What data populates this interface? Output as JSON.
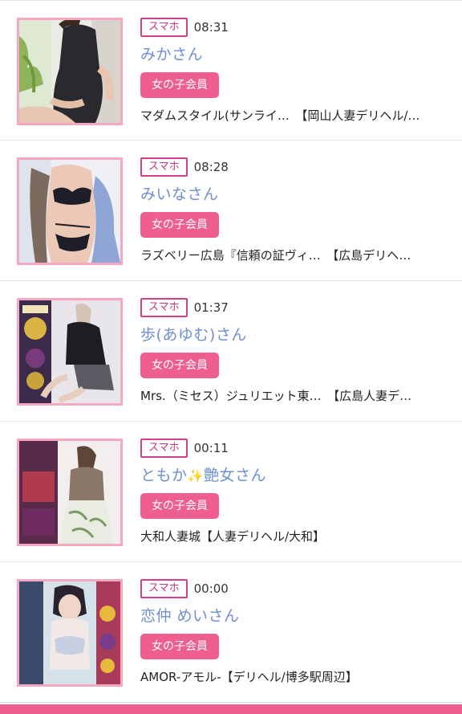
{
  "entries": [
    {
      "device": "スマホ",
      "time": "08:31",
      "name": "みかさん",
      "badge": "女の子会員",
      "shop": "マダムスタイル(サンライ…　【岡山人妻デリヘル/…",
      "thumb_icon": "woman-black-dress-photo"
    },
    {
      "device": "スマホ",
      "time": "08:28",
      "name": "みいなさん",
      "badge": "女の子会員",
      "shop": "ラズベリー広島『信頼の証ヴィ…　【広島デリヘ…",
      "thumb_icon": "woman-lingerie-photo"
    },
    {
      "device": "スマホ",
      "time": "01:37",
      "name": "歩(あゆむ)さん",
      "badge": "女の子会員",
      "shop": "Mrs.（ミセス）ジュリエット東…　【広島人妻デ…",
      "thumb_icon": "woman-sitting-photo"
    },
    {
      "device": "スマホ",
      "time": "00:11",
      "name_prefix": "ともか",
      "name_suffix": "艶女さん",
      "badge": "女の子会員",
      "shop": "大和人妻城【人妻デリヘル/大和】",
      "thumb_icon": "woman-floral-skirt-photo"
    },
    {
      "device": "スマホ",
      "time": "00:00",
      "name": "恋仲 めいさん",
      "badge": "女の子会員",
      "shop": "AMOR-アモル-【デリヘル/博多駅周辺】",
      "thumb_icon": "woman-promo-photo"
    }
  ],
  "colors": {
    "accent_pink": "#ef5f8e",
    "name_blue": "#6f8fd0",
    "thumb_border": "#f6a8c0"
  }
}
